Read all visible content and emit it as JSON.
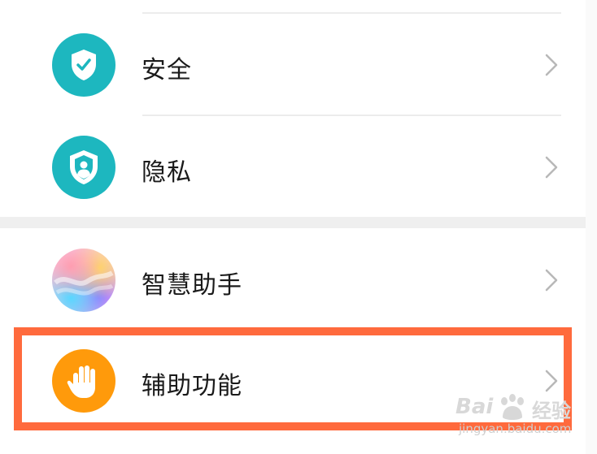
{
  "settings": {
    "items": [
      {
        "label": "安全",
        "icon": "shield-check-icon",
        "icon_color": "#1db7bf"
      },
      {
        "label": "隐私",
        "icon": "shield-person-icon",
        "icon_color": "#1db7bf"
      },
      {
        "label": "智慧助手",
        "icon": "smart-assistant-icon",
        "icon_color": "#f6c9e4"
      },
      {
        "label": "辅助功能",
        "icon": "hand-icon",
        "icon_color": "#ff9a0b"
      }
    ],
    "highlighted_item": "辅助功能",
    "highlight_color": "#ff6a3d"
  },
  "watermark": {
    "brand": "Bai",
    "brand_suffix": "经验",
    "site": "jingyan.baidu.com"
  }
}
